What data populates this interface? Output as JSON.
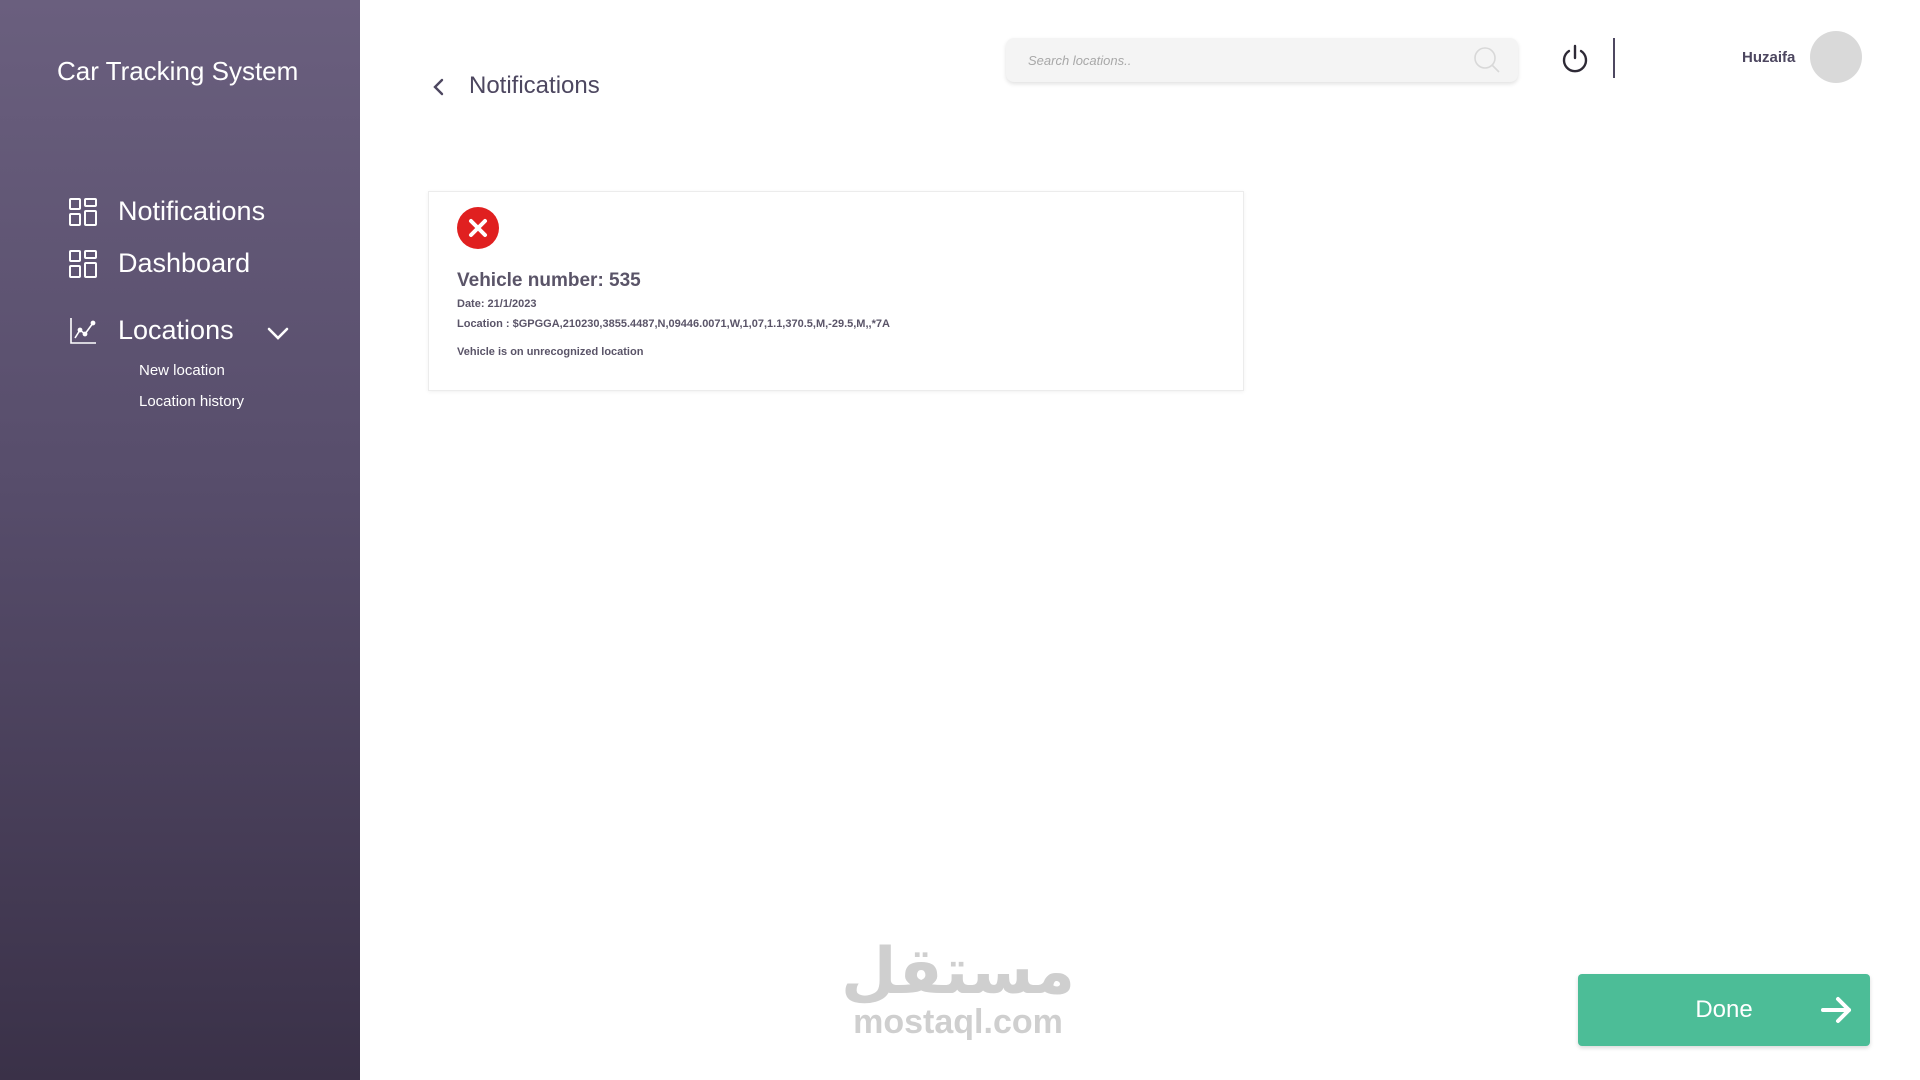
{
  "sidebar": {
    "app_title": "Car Tracking System",
    "items": [
      {
        "label": "Notifications",
        "icon": "grid-icon"
      },
      {
        "label": "Dashboard",
        "icon": "grid-icon"
      },
      {
        "label": "Locations",
        "icon": "line-chart-icon"
      }
    ],
    "sub_items": [
      {
        "label": "New location"
      },
      {
        "label": "Location history"
      }
    ]
  },
  "header": {
    "title": "Notifications",
    "search_placeholder": "Search locations..",
    "username": "Huzaifa"
  },
  "notification": {
    "status_icon": "error-x-icon",
    "vehicle_number": "Vehicle number: 535",
    "date": "Date: 21/1/2023",
    "location": "Location : $GPGGA,210230,3855.4487,N,09446.0071,W,1,07,1.1,370.5,M,-29.5,M,,*7A",
    "message": "Vehicle is on unrecognized location"
  },
  "watermark": {
    "arabic": "مستقل",
    "latin": "mostaql.com"
  },
  "actions": {
    "done_label": "Done"
  },
  "colors": {
    "sidebar_top": "#6a5f7e",
    "sidebar_bottom": "#3a3148",
    "accent_green": "#4cbd97",
    "error_red": "#e02020",
    "text_primary": "#4d4760"
  }
}
